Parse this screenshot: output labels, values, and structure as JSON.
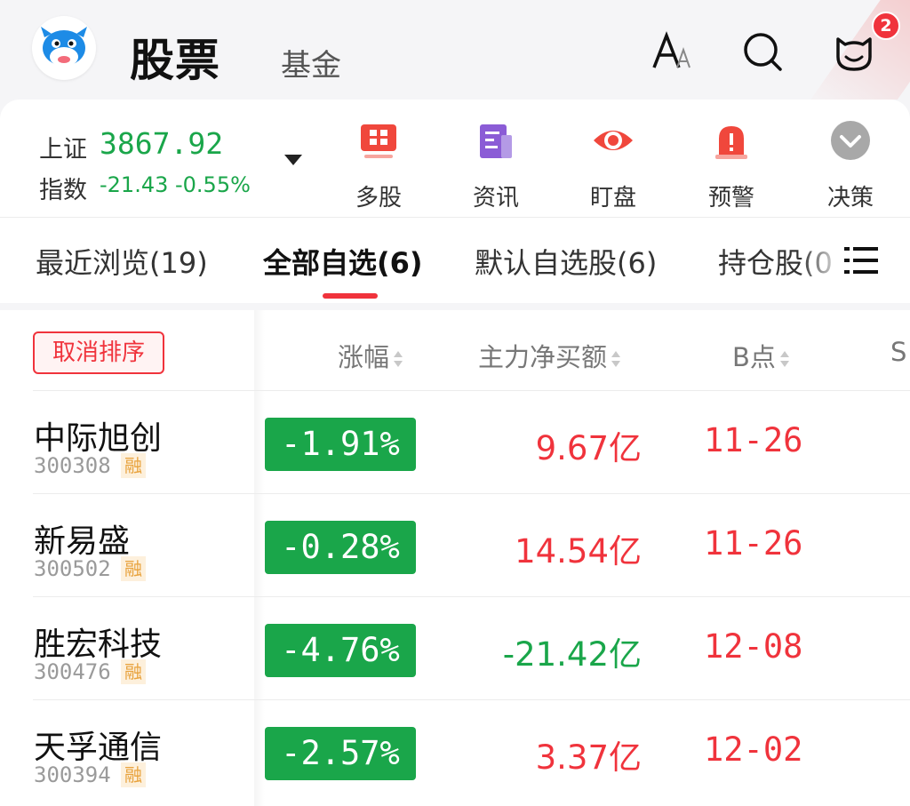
{
  "header": {
    "title": "股票",
    "subtab": "基金",
    "badge_count": "2",
    "icons": [
      "font-size-icon",
      "search-icon",
      "message-icon"
    ]
  },
  "index": {
    "name_line1": "上证",
    "name_line2": "指数",
    "value": "3867.92",
    "change": "-21.43 -0.55%",
    "color": "#1aa64a"
  },
  "quick_actions": [
    {
      "label": "多股",
      "icon": "multi-stock-icon",
      "color": "#f0473c"
    },
    {
      "label": "资讯",
      "icon": "news-icon",
      "color": "#8b5cd6"
    },
    {
      "label": "盯盘",
      "icon": "eye-icon",
      "color": "#f0473c"
    },
    {
      "label": "预警",
      "icon": "alarm-icon",
      "color": "#f0473c"
    },
    {
      "label": "决策",
      "icon": "chevron-down-icon",
      "color": "#a0a0a0"
    }
  ],
  "tabs": [
    {
      "label": "最近浏览(19)",
      "active": false
    },
    {
      "label": "全部自选(6)",
      "active": true
    },
    {
      "label": "默认自选股(6)",
      "active": false
    },
    {
      "label": "持仓股(0",
      "active": false
    }
  ],
  "table": {
    "sort_button": "取消排序",
    "columns": [
      "涨幅",
      "主力净买额",
      "B点",
      "S"
    ],
    "rows": [
      {
        "name": "中际旭创",
        "code": "300308",
        "tag": "融",
        "change": "-1.91%",
        "net": "9.67亿",
        "net_sign": "pos",
        "bpoint": "11-26"
      },
      {
        "name": "新易盛",
        "code": "300502",
        "tag": "融",
        "change": "-0.28%",
        "net": "14.54亿",
        "net_sign": "pos",
        "bpoint": "11-26"
      },
      {
        "name": "胜宏科技",
        "code": "300476",
        "tag": "融",
        "change": "-4.76%",
        "net": "-21.42亿",
        "net_sign": "neg",
        "bpoint": "12-08"
      },
      {
        "name": "天孚通信",
        "code": "300394",
        "tag": "融",
        "change": "-2.57%",
        "net": "3.37亿",
        "net_sign": "pos",
        "bpoint": "12-02"
      }
    ]
  },
  "colors": {
    "up": "#f0333c",
    "down": "#1aa64a",
    "accent": "#f0333c"
  }
}
